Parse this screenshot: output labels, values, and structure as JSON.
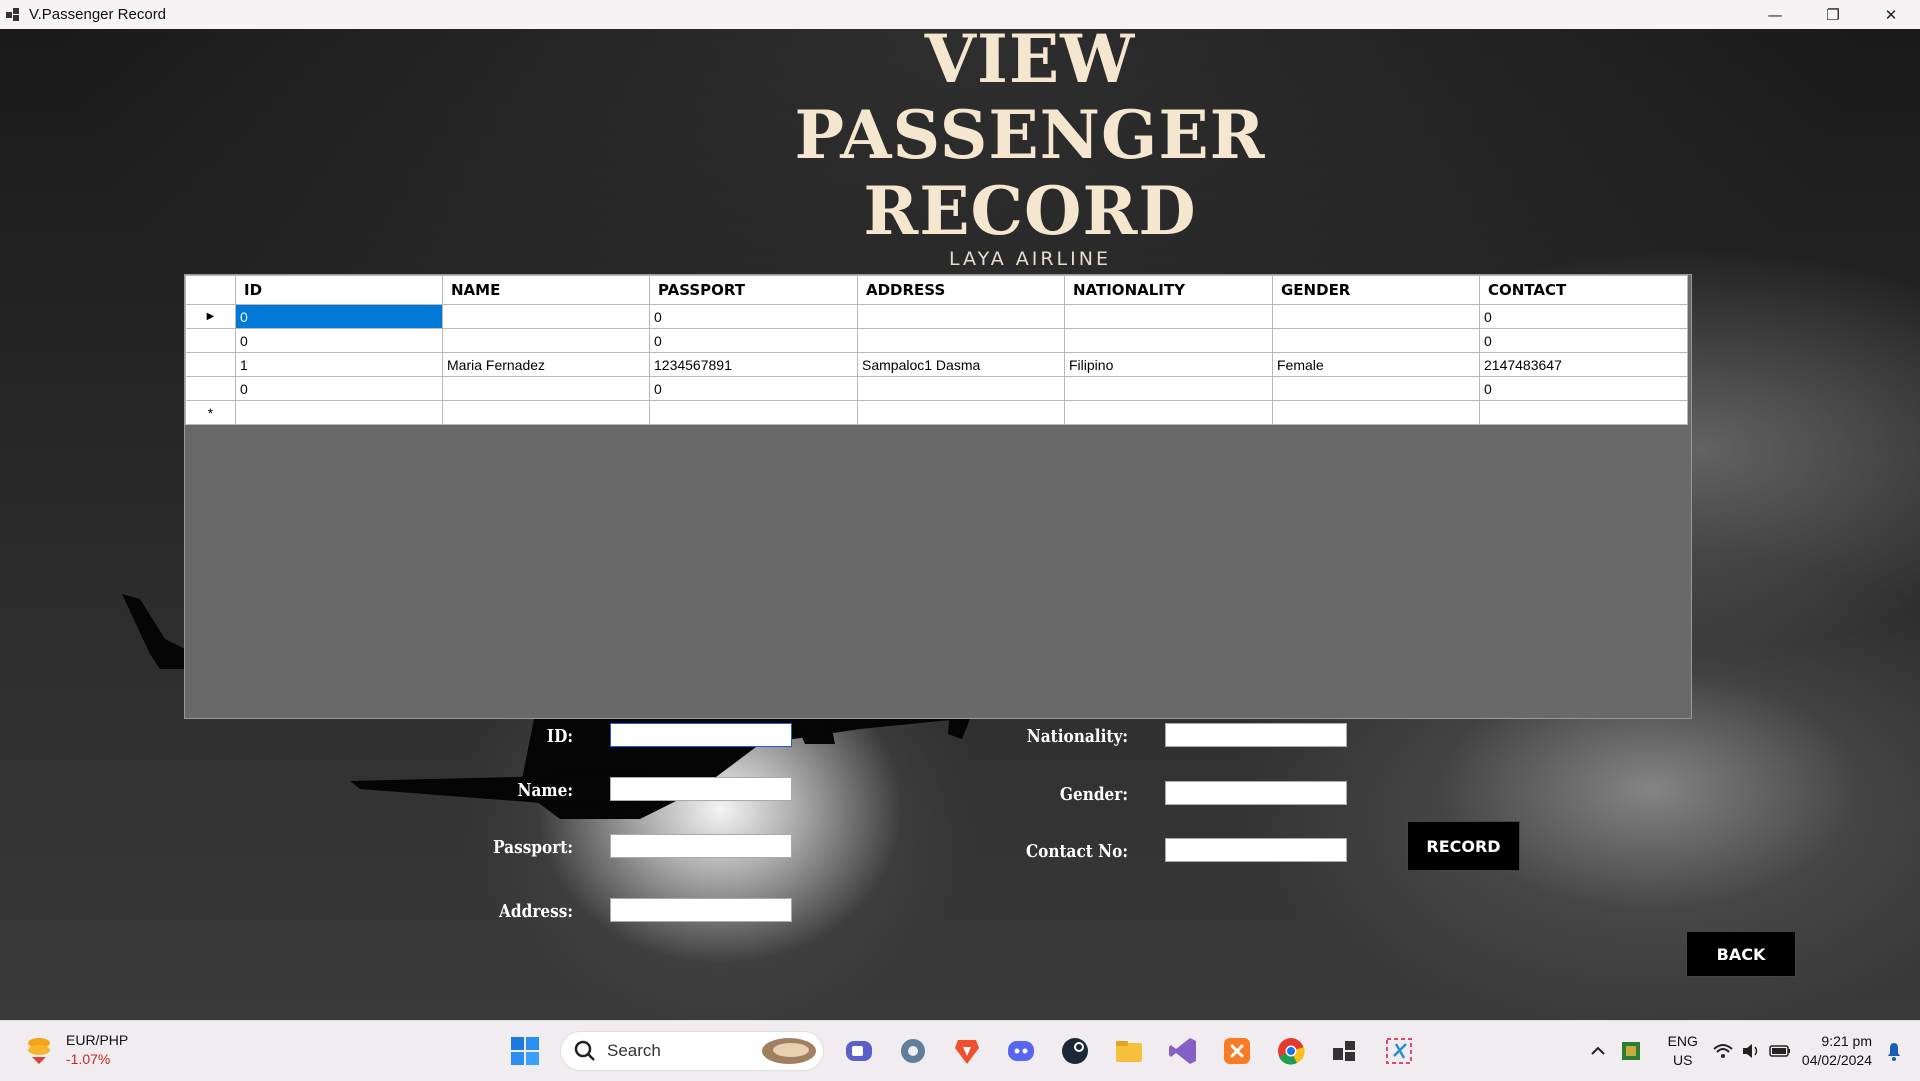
{
  "window": {
    "title": "V.Passenger Record",
    "minimize_glyph": "—",
    "maximize_glyph": "❐",
    "close_glyph": "✕"
  },
  "header": {
    "title_line1": "VIEW",
    "title_line2": "PASSENGER",
    "title_line3": "RECORD",
    "subtitle": "LAYA AIRLINE"
  },
  "grid": {
    "columns": [
      "ID",
      "NAME",
      "PASSPORT",
      "ADDRESS",
      "NATIONALITY",
      "GENDER",
      "CONTACT"
    ],
    "rows": [
      [
        "0",
        "",
        "0",
        "",
        "",
        "",
        "0"
      ],
      [
        "0",
        "",
        "0",
        "",
        "",
        "",
        "0"
      ],
      [
        "1",
        "Maria Fernadez",
        "1234567891",
        "Sampaloc1 Dasma",
        "Filipino",
        "Female",
        "2147483647"
      ],
      [
        "0",
        "",
        "0",
        "",
        "",
        "",
        "0"
      ]
    ],
    "current_row_glyph": "▶",
    "new_row_glyph": "*"
  },
  "form": {
    "id_label": "ID:",
    "name_label": "Name:",
    "passport_label": "Passport:",
    "address_label": "Address:",
    "nationality_label": "Nationality:",
    "gender_label": "Gender:",
    "contact_label": "Contact No:",
    "id_value": "",
    "name_value": "",
    "passport_value": "",
    "address_value": "",
    "nationality_value": "",
    "gender_value": "",
    "contact_value": "",
    "record_button": "RECORD",
    "back_button": "BACK"
  },
  "taskbar": {
    "ticker_pair": "EUR/PHP",
    "ticker_change": "-1.07%",
    "search_label": "Search",
    "lang_line1": "ENG",
    "lang_line2": "US",
    "time": "9:21 pm",
    "date": "04/02/2024"
  },
  "colors": {
    "selection": "#0078d7",
    "title_text": "#f4e6cf",
    "grid_background": "#696969"
  }
}
